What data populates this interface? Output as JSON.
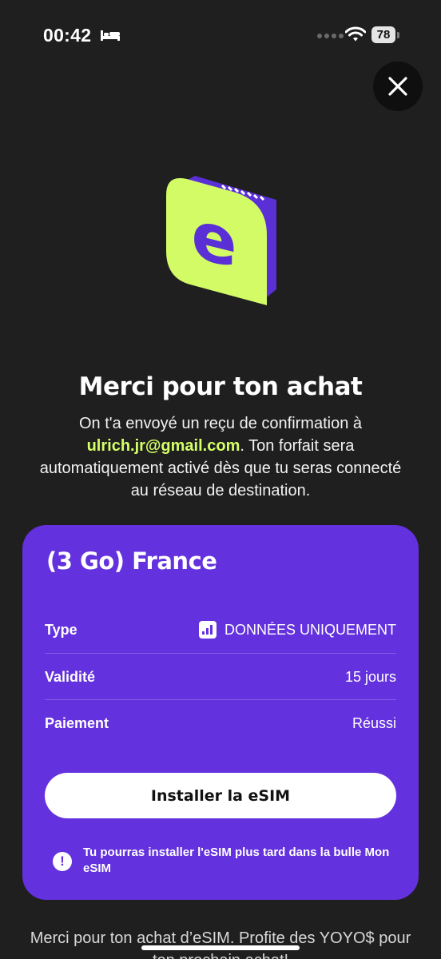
{
  "status_bar": {
    "time": "00:42",
    "battery": "78"
  },
  "icons": {
    "close": "close-icon",
    "logo": "esim-logo",
    "bed": "bed-icon",
    "wifi": "wifi-icon",
    "data_type": "bar-chart-icon",
    "info": "exclamation-icon"
  },
  "colors": {
    "background": "#1f1f1f",
    "card": "#6331dd",
    "accent": "#d4ff66"
  },
  "header": {
    "title": "Merci pour ton achat",
    "description_before": "On t'a envoyé un reçu de confirmation à ",
    "email": "ulrich.jr@gmail.com",
    "description_after": ". Ton forfait sera automatiquement activé dès que tu seras connecté au réseau de destination."
  },
  "plan": {
    "name": "(3 Go) France",
    "rows": [
      {
        "label": "Type",
        "value": "DONNÉES UNIQUEMENT"
      },
      {
        "label": "Validité",
        "value": "15 jours"
      },
      {
        "label": "Paiement",
        "value": "Réussi"
      }
    ],
    "install_label": "Installer la eSIM",
    "note": "Tu pourras installer l'eSIM plus tard dans la bulle Mon eSIM"
  },
  "footer": {
    "text": "Merci pour ton achat d’eSIM. Profite des YOYO$ pour ton prochain achat!"
  }
}
